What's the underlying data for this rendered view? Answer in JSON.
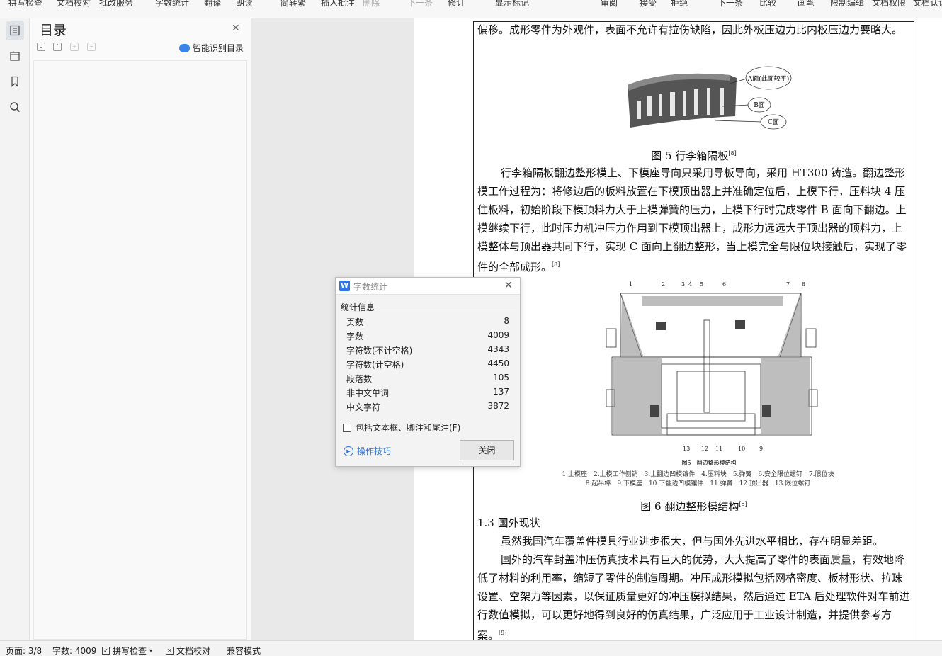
{
  "ribbon": {
    "items": [
      "拼写检查",
      "文档校对",
      "批改服务",
      "字数统计",
      "翻译",
      "朗读",
      "简转繁",
      "插入批注",
      "删除",
      "下一条",
      "修订",
      "显示标记",
      "审阅",
      "接受",
      "拒绝",
      "下一条",
      "比较",
      "画笔",
      "限制编辑",
      "文档权限",
      "文档认证"
    ]
  },
  "toc": {
    "title": "目录",
    "smart_label": "智能识别目录"
  },
  "document": {
    "p_top": "偏移。成形零件为外观件，表面不允许有拉伤缺陷，因此外板压边力比内板压边力要略大。",
    "fig5_labels": {
      "a": "A面(此面较平)",
      "b": "B面",
      "c": "C面"
    },
    "fig5_caption": "图 5 行李箱隔板",
    "fig5_ref": "[8]",
    "p_mold": "行李箱隔板翻边整形模上、下模座导向只采用导板导向，采用 HT300 铸造。翻边整形模工作过程为：将修边后的板料放置在下模顶出器上并准确定位后，上模下行，压料块 4 压住板料，初始阶段下模顶料力大于上模弹簧的压力，上模下行时完成零件 B 面向下翻边。上模继续下行，此时压力机冲压力作用到下模顶出器上，成形力远远大于顶出器的顶料力，上模整体与顶出器共同下行，实现 C 面向上翻边整形，当上模完全与限位块接触后，实现了零件的全部成形。",
    "p_mold_ref": "[8]",
    "fig6_top_nums": [
      "1",
      "2",
      "3",
      "4",
      "5",
      "6",
      "7",
      "8"
    ],
    "fig6_bottom_nums": [
      "13",
      "12",
      "11",
      "10",
      "9"
    ],
    "fig6_inner_title": "图5　翻边整形模结构",
    "fig6_legend_1": "1.上模座　2.上模工作侧销　3.上翻边凹模镶件　4.压料块　5.弹簧　6.安全限位螺钉　7.限位块",
    "fig6_legend_2": "8.起吊棒　9.下模座　10.下翻边凹模镶件　11.弹簧　12.顶出器　13.限位螺钉",
    "fig6_caption": "图 6 翻边整形模结构",
    "fig6_ref": "[8]",
    "heading_13": "1.3 国外现状",
    "p_gap": "虽然我国汽车覆盖件模具行业进步很大，但与国外先进水平相比，存在明显差距。",
    "p_foreign": "国外的汽车封盖冲压仿真技术具有巨大的优势，大大提高了零件的表面质量，有效地降低了材料的利用率，缩短了零件的制造周期。冲压成形模拟包括网格密度、板材形状、拉珠设置、空架力等因素，以保证质量更好的冲压模拟结果，然后通过 ETA 后处理软件对车前进行数值模拟，可以更好地得到良好的仿真结果，广泛应用于工业设计制造，并提供参考方案。",
    "p_foreign_ref": "[9]"
  },
  "dialog": {
    "logo": "W",
    "title": "字数统计",
    "section": "统计信息",
    "rows": [
      {
        "label": "页数",
        "value": "8"
      },
      {
        "label": "字数",
        "value": "4009"
      },
      {
        "label": "字符数(不计空格)",
        "value": "4343"
      },
      {
        "label": "字符数(计空格)",
        "value": "4450"
      },
      {
        "label": "段落数",
        "value": "105"
      },
      {
        "label": "非中文单词",
        "value": "137"
      },
      {
        "label": "中文字符",
        "value": "3872"
      }
    ],
    "checkbox_label": "包括文本框、脚注和尾注(F)",
    "checkbox_checked": false,
    "tips_label": "操作技巧",
    "close_label": "关闭"
  },
  "statusbar": {
    "page": "页面: 3/8",
    "words": "字数: 4009",
    "spell": "拼写检查",
    "proof": "文档校对",
    "compat": "兼容模式"
  },
  "colors": {
    "accent": "#2f74e0",
    "frame": "#222222"
  }
}
